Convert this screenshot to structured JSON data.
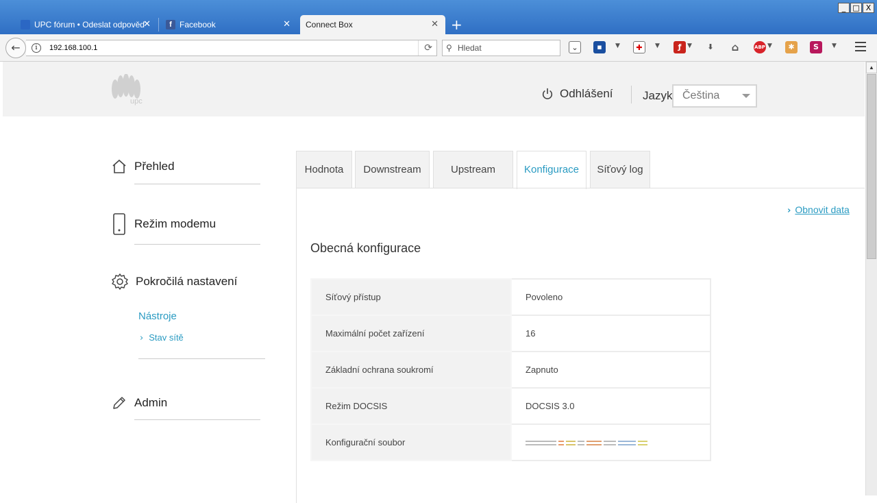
{
  "browser": {
    "tabs": [
      {
        "label": "UPC fórum • Odeslat odpověď",
        "favicon_color": "#2b67c4"
      },
      {
        "label": "Facebook",
        "favicon_color": "#3b5998"
      },
      {
        "label": "Connect Box",
        "favicon_color": ""
      }
    ],
    "window_controls": [
      "_",
      "□",
      "X"
    ],
    "new_tab": "+",
    "url": "192.168.100.1",
    "search_placeholder": "Hledat"
  },
  "header": {
    "logo_text": "upc",
    "logout_label": "Odhlášení",
    "language_label": "Jazyk",
    "language_value": "Čeština"
  },
  "sidebar": {
    "items": [
      {
        "label": "Přehled",
        "icon": "home-icon"
      },
      {
        "label": "Režim modemu",
        "icon": "modem-icon"
      },
      {
        "label": "Pokročilá nastavení",
        "icon": "gear-icon"
      },
      {
        "label": "Admin",
        "icon": "pencil-icon"
      }
    ],
    "sub_section": "Nástroje",
    "sub_item": "Stav sítě"
  },
  "tabs": [
    "Hodnota",
    "Downstream",
    "Upstream",
    "Konfigurace",
    "Síťový log"
  ],
  "active_tab": "Konfigurace",
  "refresh_label": "Obnovit data",
  "section_title": "Obecná konfigurace",
  "config_rows": [
    {
      "key": "Síťový přístup",
      "value": "Povoleno"
    },
    {
      "key": "Maximální počet zařízení",
      "value": "16"
    },
    {
      "key": "Základní ochrana soukromí",
      "value": "Zapnuto"
    },
    {
      "key": "Režim DOCSIS",
      "value": "DOCSIS 3.0"
    },
    {
      "key": "Konfigurační soubor",
      "value": ""
    }
  ],
  "colors": {
    "accent": "#2a9bc2",
    "titlebar": "#3a7bd0"
  }
}
